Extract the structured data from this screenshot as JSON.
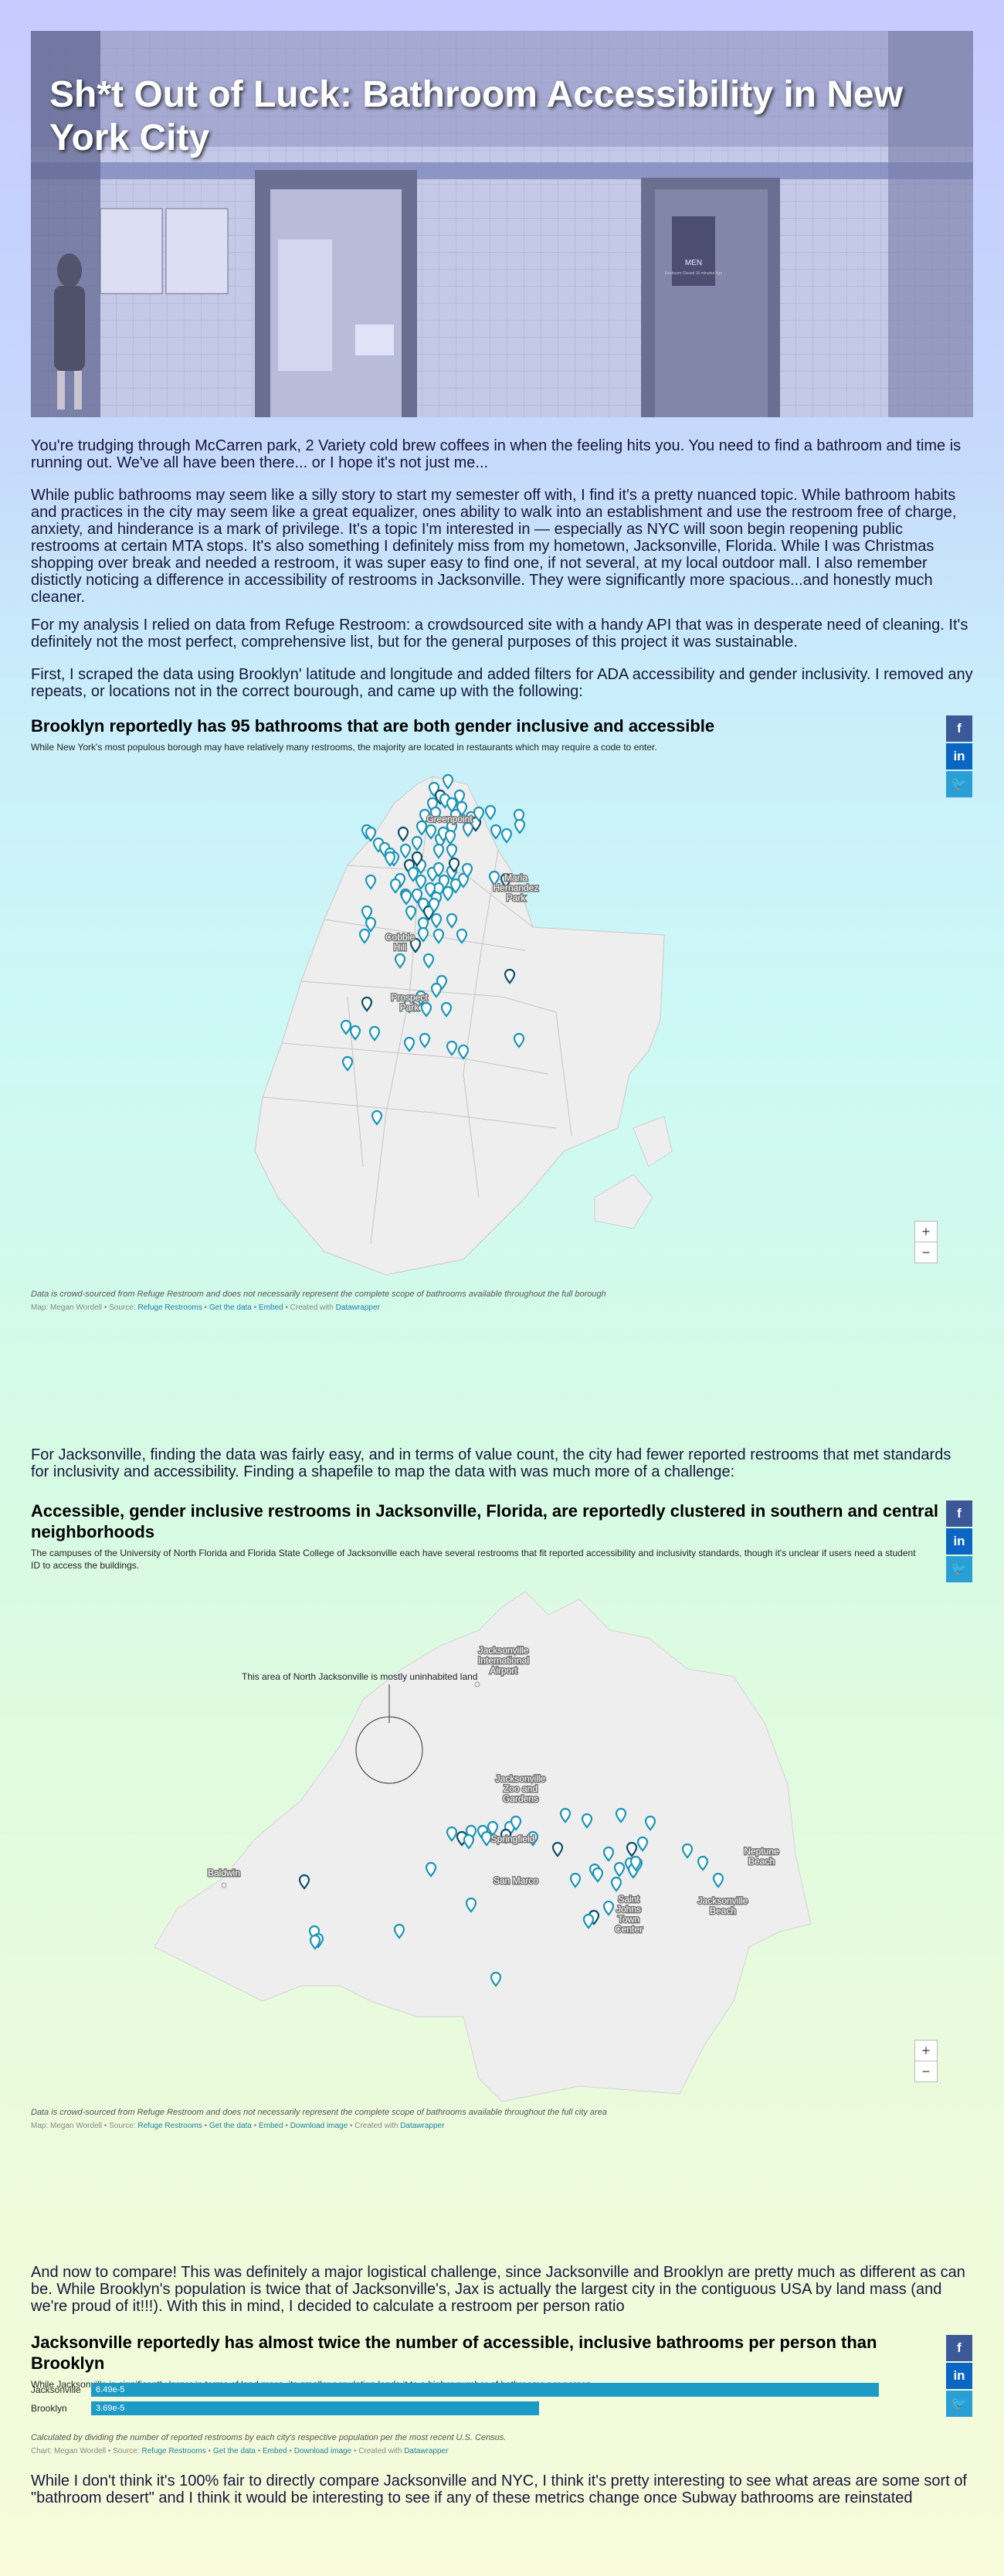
{
  "article": {
    "title": "Sh*t Out of Luck: Bathroom Accessibility in New York City",
    "paragraphs": [
      "You're trudging through McCarren park, 2 Variety cold brew coffees in when the feeling hits you. You need to find a bathroom and time is running out. We've all have been there... or I hope it's not just me...",
      "While public bathrooms may seem like a silly story to start my semester off with, I find it's a pretty nuanced topic. While bathroom habits and practices in the city may seem like a great equalizer, ones ability to walk into an establishment and use the restroom free of charge, anxiety, and hinderance is a mark of privilege. It's a topic I'm interested in — especially as NYC will soon begin reopening public restrooms at certain MTA stops. It's also something I definitely miss from my hometown, Jacksonville, Florida. While I was Christmas shopping over break and needed a restroom, it was super easy to find one, if not several, at my local outdoor mall. I also remember distictly noticing a difference in accessibility of restrooms in Jacksonville. They were significantly more spacious...and honestly much cleaner.",
      "For my analysis I relied on data from Refuge Restroom: a crowdsourced site with a handy API that was in desperate need of cleaning. It's definitely not the most perfect, comprehensive list, but for the general purposes of this project it was sustainable.",
      "First, I scraped the data using Brooklyn' latitude and longitude and added filters for ADA accessibility and gender inclusivity. I removed any repeats, or locations not in the correct bourough, and came up with the following:",
      "For Jacksonville, finding the data was fairly easy, and in terms of value count, the city had fewer reported restrooms that met standards for inclusivity and accessibility. Finding a shapefile to map the data with was much more of a challenge:",
      "And now to compare! This was definitely a major logistical challenge, since Jacksonville and Brooklyn are pretty much as different as can be. While Brooklyn's population is twice that of Jacksonville's, Jax is actually the largest city in the contiguous USA by land mass (and we're proud of it!!!). With this in mind, I decided to calculate a restroom per person ratio",
      "While I don't think it's 100% fair to directly compare Jacksonville and NYC, I think it's pretty interesting to see what areas are some sort of \"bathroom desert\" and I think it would be interesting to see if any of these metrics change once Subway bathrooms are reinstated"
    ]
  },
  "hero_photo": {
    "sign_text": "MEN",
    "sign_subtext": "Restroom Closed 10 minutes Ago"
  },
  "share": {
    "facebook": "f",
    "linkedin": "in",
    "twitter": "🐦"
  },
  "zoom": {
    "in": "+",
    "out": "−"
  },
  "brooklyn_map": {
    "title": "Brooklyn reportedly has 95 bathrooms that are both gender inclusive and accessible",
    "description": "While New York's most populous borough may have relatively many restrooms, the majority are located in restaurants which may require a code to enter.",
    "labels": {
      "greenpoint": "Greenpoint",
      "maria": "Maria",
      "hernandez": "Hernandez",
      "park": "Park",
      "cobble": "Cobble",
      "hill": "Hill",
      "prospect": "Prospect",
      "prospect_park": "Park"
    },
    "notes": "Data is crowd-sourced from Refuge Restroom and does not necessarily represent the complete scope of bathrooms available throughout the full borough",
    "source": {
      "prefix": "Map: Megan Wordell • Source: ",
      "link1": "Refuge Restrooms",
      "sep1": " • ",
      "link2": "Get the data",
      "sep2": " • ",
      "link3": "Embed",
      "sep3": " • Created with ",
      "link4": "Datawrapper"
    }
  },
  "jacksonville_map": {
    "title": "Accessible, gender inclusive restrooms in Jacksonville, Florida, are reportedly clustered in southern and central neighborhoods",
    "description": "The campuses of the University of North Florida and Florida State College of Jacksonville each have several restrooms that fit reported accessibility and inclusivity standards, though it's unclear if users need a student ID to access the buildings.",
    "annotation": "This area of North Jacksonville is mostly uninhabited land",
    "labels": {
      "airport1": "Jacksonville",
      "airport2": "International",
      "airport3": "Airport",
      "zoo1": "Jacksonville",
      "zoo2": "Zoo and",
      "zoo3": "Gardens",
      "springfield": "Springfield",
      "sanmarco": "San Marco",
      "baldwin": "Baldwin",
      "neptune1": "Neptune",
      "neptune2": "Beach",
      "jaxbeach1": "Jacksonville",
      "jaxbeach2": "Beach",
      "stjohns1": "Saint",
      "stjohns2": "Johns",
      "stjohns3": "Town",
      "stjohns4": "Center"
    },
    "notes": "Data is crowd-sourced from Refuge Restroom and does not necessarily represent the complete scope of bathrooms available throughout the full city area",
    "source": {
      "prefix": "Map: Megan Wordell • Source: ",
      "link1": "Refuge Restrooms",
      "sep1": " • ",
      "link2": "Get the data",
      "sep2": " • ",
      "link3": "Embed",
      "sep3": " • ",
      "link4": "Download image",
      "sep4": " • Created with ",
      "link5": "Datawrapper"
    }
  },
  "chart_data": {
    "type": "bar",
    "orientation": "horizontal",
    "title": "Jacksonville reportedly has almost twice the number of accessible, inclusive bathrooms per person than Brooklyn",
    "subtitle": "While Jacksonville is significantly larger in terms of land mass, its smaller population lends it to a higher number of bathrooms per person",
    "categories": [
      "Jacksonville",
      "Brooklyn"
    ],
    "values": [
      6.49e-05,
      3.69e-05
    ],
    "value_labels": [
      "6.49e-5",
      "3.69e-5"
    ],
    "color": "#1d9bc7",
    "notes": "Calculated by dividing the number of reported restrooms by each city's respective population per the most recent U.S. Census.",
    "source": {
      "prefix": "Chart: Megan Wordell • Source: ",
      "link1": "Refuge Restrooms",
      "sep1": " • ",
      "link2": "Get the data",
      "sep2": " • ",
      "link3": "Embed",
      "sep3": " • ",
      "link4": "Download image",
      "sep4": " • Created with ",
      "link5": "Datawrapper"
    }
  },
  "colors": {
    "pin": "#1b95b8",
    "pin_dark": "#0b4f6c",
    "land": "#eeeeee",
    "share_fb": "#3b5998",
    "share_li": "#0a66c2",
    "share_tw": "#2a9fd6"
  }
}
